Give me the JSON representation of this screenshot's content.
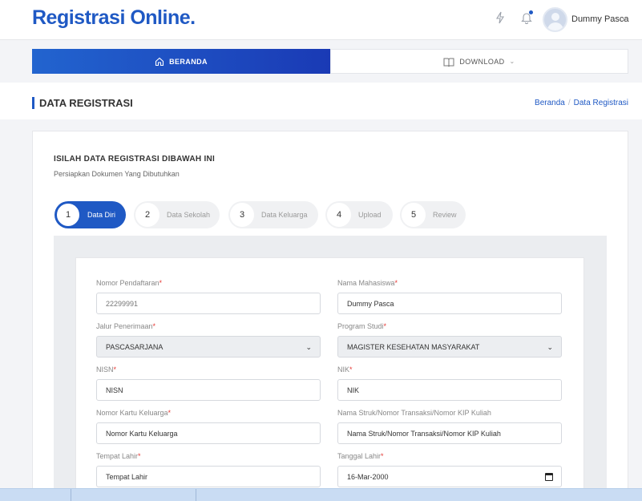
{
  "header": {
    "brand": "Registrasi Online.",
    "user_name": "Dummy Pasca",
    "icons": [
      "bolt-icon",
      "bell-icon",
      "avatar",
      "chevron-down-icon"
    ]
  },
  "nav": {
    "home_label": "BERANDA",
    "download_label": "DOWNLOAD"
  },
  "page": {
    "title": "DATA REGISTRASI",
    "breadcrumb": [
      "Beranda",
      "Data Registrasi"
    ]
  },
  "card": {
    "title": "ISILAH DATA REGISTRASI DIBAWAH INI",
    "subtitle": "Persiapkan Dokumen Yang Dibutuhkan"
  },
  "steps": [
    {
      "num": "1",
      "label": "Data Diri",
      "active": true
    },
    {
      "num": "2",
      "label": "Data Sekolah",
      "active": false
    },
    {
      "num": "3",
      "label": "Data Keluarga",
      "active": false
    },
    {
      "num": "4",
      "label": "Upload",
      "active": false
    },
    {
      "num": "5",
      "label": "Review",
      "active": false
    }
  ],
  "form": {
    "nomor_pendaftaran": {
      "label": "Nomor Pendaftaran",
      "value": "22299991"
    },
    "nama_mahasiswa": {
      "label": "Nama Mahasiswa",
      "value": "Dummy Pasca"
    },
    "jalur_penerimaan": {
      "label": "Jalur Penerimaan",
      "value": "PASCASARJANA"
    },
    "program_studi": {
      "label": "Program Studi",
      "value": "MAGISTER KESEHATAN MASYARAKAT"
    },
    "nisn": {
      "label": "NISN",
      "placeholder": "NISN"
    },
    "nik": {
      "label": "NIK",
      "placeholder": "NIK"
    },
    "nomor_kk": {
      "label": "Nomor Kartu Keluarga",
      "placeholder": "Nomor Kartu Keluarga"
    },
    "nama_struk": {
      "label": "Nama Struk/Nomor Transaksi/Nomor KIP Kuliah",
      "placeholder": "Nama Struk/Nomor Transaksi/Nomor KIP Kuliah"
    },
    "tempat_lahir": {
      "label": "Tempat Lahir",
      "placeholder": "Tempat Lahir"
    },
    "tanggal_lahir": {
      "label": "Tanggal Lahir",
      "value": "16-Mar-2000"
    },
    "required_mark": "*"
  },
  "colors": {
    "brand": "#1f59c4",
    "required": "#e53935"
  }
}
